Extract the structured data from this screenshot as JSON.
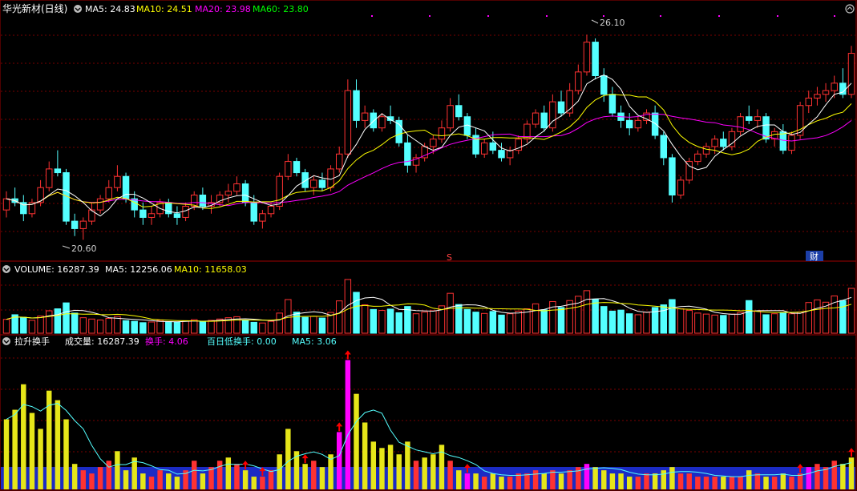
{
  "colors": {
    "up": "#ff3232",
    "down": "#54ffff",
    "bg": "#000000",
    "grid": "#7a0000",
    "ma5": "#ffffff",
    "ma10": "#ffff00",
    "ma20": "#ff00ff",
    "ma60": "#00ff00",
    "blueband": "#1b2bc4",
    "turnover_up": "#e6e619",
    "turnover_high": "#ff00ff"
  },
  "price_panel": {
    "title": "华光新材(日线)",
    "ma5": "MA5: 24.83",
    "ma10": "MA10: 24.51",
    "ma20": "MA20: 23.98",
    "ma60": "MA60: 23.80",
    "high_marker": "26.10",
    "low_marker": "20.60",
    "event_s": "S",
    "event_cai": "财"
  },
  "volume_panel": {
    "title": "VOLUME: 16287.39",
    "ma5": "MA5: 12256.06",
    "ma10": "MA10: 11658.03"
  },
  "turnover_panel": {
    "title": "拉升换手",
    "vol": "成交量: 16287.39",
    "turnover": "换手: 4.06",
    "low100": "百日低换手: 0.00",
    "ma5": "MA5: 3.06"
  },
  "chart_data": [
    {
      "type": "candlestick",
      "title": "华光新材(日线)",
      "ylim": [
        20.2,
        26.6
      ],
      "annotations": [
        {
          "label": "26.10",
          "type": "high"
        },
        {
          "label": "20.60",
          "type": "low"
        }
      ],
      "ohlc": [
        [
          21.4,
          21.9,
          21.2,
          21.7
        ],
        [
          21.7,
          22.0,
          21.5,
          21.6
        ],
        [
          21.6,
          21.8,
          21.1,
          21.3
        ],
        [
          21.3,
          21.7,
          21.2,
          21.6
        ],
        [
          21.6,
          22.2,
          21.5,
          22.0
        ],
        [
          22.0,
          22.7,
          21.9,
          22.5
        ],
        [
          22.5,
          23.0,
          22.3,
          22.4
        ],
        [
          22.4,
          22.5,
          21.0,
          21.1
        ],
        [
          21.1,
          21.3,
          20.7,
          20.9
        ],
        [
          20.9,
          21.2,
          20.6,
          21.1
        ],
        [
          21.1,
          21.6,
          21.0,
          21.4
        ],
        [
          21.4,
          21.8,
          21.3,
          21.7
        ],
        [
          21.7,
          22.2,
          21.6,
          22.0
        ],
        [
          22.0,
          22.6,
          21.9,
          22.3
        ],
        [
          22.3,
          22.4,
          21.6,
          21.7
        ],
        [
          21.7,
          21.9,
          21.2,
          21.4
        ],
        [
          21.4,
          21.6,
          21.0,
          21.2
        ],
        [
          21.2,
          21.5,
          21.0,
          21.3
        ],
        [
          21.3,
          21.7,
          21.2,
          21.6
        ],
        [
          21.6,
          21.7,
          21.2,
          21.3
        ],
        [
          21.3,
          21.5,
          21.0,
          21.2
        ],
        [
          21.2,
          21.6,
          21.1,
          21.5
        ],
        [
          21.5,
          21.9,
          21.4,
          21.8
        ],
        [
          21.8,
          22.0,
          21.4,
          21.5
        ],
        [
          21.5,
          21.8,
          21.3,
          21.6
        ],
        [
          21.6,
          21.9,
          21.5,
          21.8
        ],
        [
          21.8,
          22.1,
          21.6,
          21.9
        ],
        [
          21.9,
          22.3,
          21.8,
          22.1
        ],
        [
          22.1,
          22.2,
          21.5,
          21.6
        ],
        [
          21.6,
          21.8,
          21.0,
          21.1
        ],
        [
          21.1,
          21.4,
          20.9,
          21.3
        ],
        [
          21.3,
          21.6,
          21.2,
          21.5
        ],
        [
          21.5,
          22.4,
          21.4,
          22.3
        ],
        [
          22.3,
          22.9,
          22.2,
          22.7
        ],
        [
          22.7,
          22.8,
          22.3,
          22.4
        ],
        [
          22.4,
          22.5,
          21.9,
          22.0
        ],
        [
          22.0,
          22.3,
          21.8,
          22.2
        ],
        [
          22.2,
          22.4,
          21.9,
          22.0
        ],
        [
          22.0,
          22.6,
          21.9,
          22.5
        ],
        [
          22.5,
          23.1,
          22.4,
          22.9
        ],
        [
          22.9,
          24.9,
          22.8,
          24.6
        ],
        [
          24.6,
          24.9,
          23.6,
          23.8
        ],
        [
          23.8,
          24.2,
          23.6,
          24.0
        ],
        [
          24.0,
          24.1,
          23.5,
          23.6
        ],
        [
          23.6,
          24.0,
          23.5,
          23.9
        ],
        [
          23.9,
          24.2,
          23.7,
          23.8
        ],
        [
          23.8,
          23.9,
          23.1,
          23.2
        ],
        [
          23.2,
          23.4,
          22.4,
          22.6
        ],
        [
          22.6,
          22.9,
          22.4,
          22.8
        ],
        [
          22.8,
          23.2,
          22.7,
          23.1
        ],
        [
          23.1,
          23.4,
          22.9,
          23.3
        ],
        [
          23.3,
          23.8,
          23.2,
          23.6
        ],
        [
          23.6,
          24.4,
          23.5,
          24.2
        ],
        [
          24.2,
          24.5,
          23.8,
          23.9
        ],
        [
          23.9,
          24.0,
          23.3,
          23.4
        ],
        [
          23.4,
          23.6,
          22.8,
          22.9
        ],
        [
          22.9,
          23.3,
          22.8,
          23.2
        ],
        [
          23.2,
          23.5,
          22.9,
          23.0
        ],
        [
          23.0,
          23.2,
          22.7,
          22.8
        ],
        [
          22.8,
          23.1,
          22.6,
          23.0
        ],
        [
          23.0,
          23.4,
          22.9,
          23.3
        ],
        [
          23.3,
          23.8,
          23.2,
          23.7
        ],
        [
          23.7,
          24.1,
          23.6,
          24.0
        ],
        [
          24.0,
          24.2,
          23.5,
          23.6
        ],
        [
          23.6,
          24.5,
          23.5,
          24.3
        ],
        [
          24.3,
          24.6,
          23.9,
          24.0
        ],
        [
          24.0,
          24.8,
          23.9,
          24.6
        ],
        [
          24.6,
          25.3,
          24.5,
          25.1
        ],
        [
          25.1,
          26.1,
          25.0,
          25.9
        ],
        [
          25.9,
          26.0,
          24.9,
          25.0
        ],
        [
          25.0,
          25.2,
          24.3,
          24.5
        ],
        [
          24.5,
          24.7,
          23.9,
          24.0
        ],
        [
          24.0,
          24.2,
          23.6,
          23.8
        ],
        [
          23.8,
          24.0,
          23.4,
          23.6
        ],
        [
          23.6,
          23.9,
          23.5,
          23.8
        ],
        [
          23.8,
          24.1,
          23.7,
          24.0
        ],
        [
          24.0,
          24.2,
          23.3,
          23.4
        ],
        [
          23.4,
          23.5,
          22.6,
          22.8
        ],
        [
          22.8,
          22.9,
          21.6,
          21.8
        ],
        [
          21.8,
          22.3,
          21.7,
          22.2
        ],
        [
          22.2,
          22.8,
          22.1,
          22.7
        ],
        [
          22.7,
          23.0,
          22.6,
          22.9
        ],
        [
          22.9,
          23.2,
          22.8,
          23.1
        ],
        [
          23.1,
          23.4,
          22.9,
          23.3
        ],
        [
          23.3,
          23.5,
          23.0,
          23.1
        ],
        [
          23.1,
          23.6,
          23.0,
          23.5
        ],
        [
          23.5,
          24.0,
          23.4,
          23.9
        ],
        [
          23.9,
          24.2,
          23.7,
          23.8
        ],
        [
          23.8,
          24.1,
          23.6,
          23.9
        ],
        [
          23.9,
          24.0,
          23.2,
          23.3
        ],
        [
          23.3,
          23.6,
          23.1,
          23.5
        ],
        [
          23.5,
          23.7,
          22.9,
          23.0
        ],
        [
          23.0,
          23.5,
          22.9,
          23.4
        ],
        [
          23.4,
          24.3,
          23.3,
          24.2
        ],
        [
          24.2,
          24.6,
          24.0,
          24.4
        ],
        [
          24.4,
          24.7,
          24.2,
          24.5
        ],
        [
          24.5,
          24.8,
          24.3,
          24.6
        ],
        [
          24.6,
          25.0,
          24.4,
          24.8
        ],
        [
          24.8,
          25.2,
          24.4,
          24.5
        ],
        [
          24.5,
          25.8,
          24.4,
          25.6
        ]
      ],
      "series": [
        {
          "name": "MA5",
          "value": 24.83
        },
        {
          "name": "MA10",
          "value": 24.51
        },
        {
          "name": "MA20",
          "value": 23.98
        },
        {
          "name": "MA60",
          "value": 23.8
        }
      ]
    },
    {
      "type": "bar",
      "title": "VOLUME: 16287.39",
      "ylim": [
        0,
        17000
      ],
      "values": [
        4200,
        5600,
        4800,
        3900,
        5200,
        6800,
        7400,
        9200,
        6100,
        4700,
        4300,
        4000,
        4500,
        5100,
        3800,
        3600,
        3200,
        3400,
        3900,
        3500,
        3300,
        3700,
        4100,
        3600,
        3900,
        4300,
        4700,
        5000,
        3900,
        3300,
        3100,
        3600,
        6100,
        10200,
        6400,
        4800,
        5100,
        4600,
        6300,
        9800,
        16287,
        12400,
        8600,
        7200,
        6900,
        7300,
        6200,
        8100,
        5900,
        6400,
        6800,
        8300,
        12100,
        8700,
        7200,
        6400,
        6000,
        6600,
        5500,
        5900,
        6700,
        7400,
        8900,
        7100,
        9600,
        7800,
        9900,
        11200,
        12900,
        10300,
        8100,
        6700,
        7000,
        5900,
        5600,
        6400,
        7800,
        8600,
        10200,
        7400,
        6900,
        6100,
        5800,
        5500,
        5400,
        5800,
        6300,
        9900,
        6700,
        5600,
        5900,
        6200,
        5900,
        6400,
        9300,
        10100,
        9400,
        11300,
        9900,
        13600
      ],
      "series": [
        {
          "name": "MA5",
          "value": 12256.06
        },
        {
          "name": "MA10",
          "value": 11658.03
        }
      ]
    },
    {
      "type": "bar",
      "title": "拉升换手",
      "ylim": [
        0,
        4.4
      ],
      "values": [
        2.2,
        2.5,
        3.3,
        2.4,
        1.9,
        3.1,
        2.8,
        2.2,
        0.8,
        0.6,
        0.5,
        0.7,
        0.9,
        1.2,
        0.6,
        1.0,
        0.5,
        0.4,
        0.6,
        0.5,
        0.4,
        0.6,
        0.9,
        0.5,
        0.7,
        0.9,
        1.0,
        0.8,
        0.6,
        0.4,
        0.4,
        0.6,
        1.1,
        1.9,
        1.2,
        0.8,
        0.9,
        0.7,
        1.1,
        1.8,
        4.06,
        3.0,
        2.1,
        1.5,
        1.3,
        1.4,
        1.1,
        1.5,
        0.9,
        1.0,
        1.1,
        1.4,
        0.9,
        0.6,
        0.5,
        0.5,
        0.4,
        0.5,
        0.4,
        0.4,
        0.5,
        0.5,
        0.6,
        0.5,
        0.6,
        0.5,
        0.6,
        0.7,
        0.8,
        0.7,
        0.6,
        0.5,
        0.5,
        0.4,
        0.4,
        0.5,
        0.5,
        0.6,
        0.7,
        0.5,
        0.5,
        0.4,
        0.4,
        0.4,
        0.4,
        0.4,
        0.4,
        0.6,
        0.5,
        0.4,
        0.4,
        0.5,
        0.4,
        0.5,
        0.7,
        0.8,
        0.7,
        0.9,
        0.8,
        1.0
      ],
      "highlight_indices": [
        39,
        40,
        54,
        68,
        94
      ],
      "arrow_indices": [
        28,
        30,
        35,
        39,
        40,
        54,
        93,
        99
      ],
      "series": [
        {
          "name": "换手",
          "value": 4.06
        },
        {
          "name": "百日低换手",
          "value": 0.0
        },
        {
          "name": "MA5",
          "value": 3.06
        }
      ]
    }
  ]
}
